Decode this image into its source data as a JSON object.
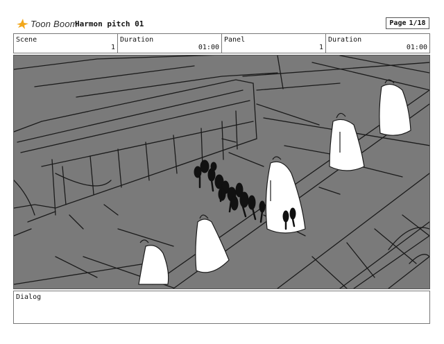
{
  "header": {
    "brand": "Toon Boom",
    "project_title": "Harmon pitch 01",
    "page_label": "Page",
    "page_value": "1/18"
  },
  "info": {
    "scene_label": "Scene",
    "scene_value": "1",
    "scene_duration_label": "Duration",
    "scene_duration_value": "01:00",
    "panel_label": "Panel",
    "panel_value": "1",
    "panel_duration_label": "Duration",
    "panel_duration_value": "01:00"
  },
  "dialog": {
    "label": "Dialog",
    "text": ""
  },
  "colors": {
    "sketch_background": "#7a7a7a",
    "sketch_lines": "#1a1a1a",
    "ghost_fill": "#ffffff",
    "logo_accent": "#f2a71b"
  },
  "icons": {
    "logo": "toon-boom-logo-icon"
  }
}
